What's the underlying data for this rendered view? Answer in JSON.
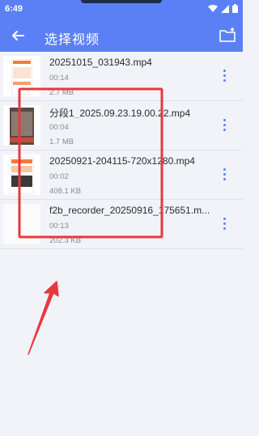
{
  "status": {
    "time": "6:49"
  },
  "appbar": {
    "title": "选择视频",
    "back_icon": "arrow-left-icon",
    "folder_icon": "folder-plus-icon",
    "bg": "#5b80f6"
  },
  "videos": [
    {
      "name": "20251015_031943.mp4",
      "duration": "00:14",
      "size": "2.7 MB"
    },
    {
      "name": "分段1_2025.09.23.19.00.22.mp4",
      "duration": "00:04",
      "size": "1.7 MB"
    },
    {
      "name": "20250921-204115-720x1280.mp4",
      "duration": "00:02",
      "size": "408.1 KB"
    },
    {
      "name": "f2b_recorder_20250916_175651.m...",
      "duration": "00:13",
      "size": "202.3 KB"
    }
  ],
  "annotation_color": "#e8383d"
}
